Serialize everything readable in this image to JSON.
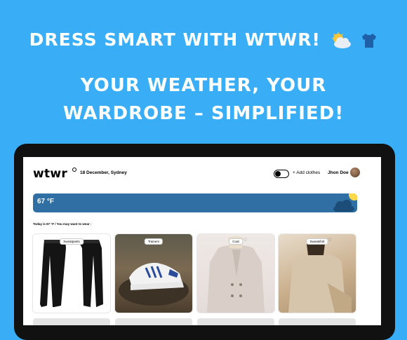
{
  "banner": {
    "line1": "DRESS SMART WITH WTWR!",
    "line2a": "YOUR WEATHER, YOUR",
    "line2b": "WARDROBE – SIMPLIFIED!"
  },
  "header": {
    "logo": "wtwr",
    "date": "18 December, Sydney",
    "add_clothes": "+ Add clothes",
    "username": "Jhon Doe"
  },
  "weather": {
    "temperature": "67 °F",
    "sun_color": "#ffd84a",
    "card_color": "#2f6fa3"
  },
  "suggestion": "Today is 67 °F / You may want to wear :",
  "items": [
    {
      "label": "Sweatpants",
      "icon": "heart-icon"
    },
    {
      "label": "Trainers",
      "icon": "heart-icon"
    },
    {
      "label": "Coat",
      "icon": "heart-icon"
    },
    {
      "label": "Sweatshirt",
      "icon": "heart-icon"
    }
  ],
  "colors": {
    "background": "#39aef7",
    "device": "#111111"
  }
}
